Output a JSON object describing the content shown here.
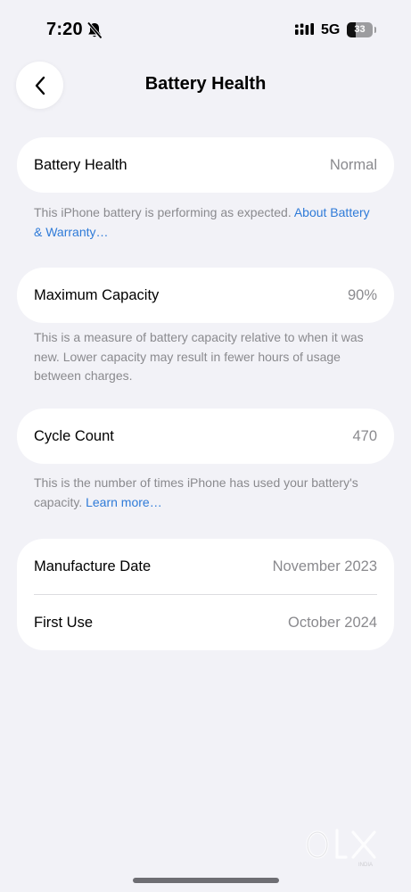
{
  "status_bar": {
    "time": "7:20",
    "network": "5G",
    "battery_percent": "33",
    "battery_level": 0.33,
    "icons": [
      "bell-muted-icon",
      "signal-icon",
      "battery-icon"
    ]
  },
  "nav": {
    "back_icon": "chevron-left-icon",
    "title": "Battery Health"
  },
  "battery_health": {
    "label": "Battery Health",
    "value": "Normal",
    "footnote_text": "This iPhone battery is performing as expected. ",
    "footnote_link": "About Battery & Warranty…"
  },
  "max_capacity": {
    "label": "Maximum Capacity",
    "value": "90%",
    "footnote": "This is a measure of battery capacity relative to when it was new. Lower capacity may result in fewer hours of usage between charges."
  },
  "cycle_count": {
    "label": "Cycle Count",
    "value": "470",
    "footnote_text": "This is the number of times iPhone has used your battery's capacity. ",
    "footnote_link": "Learn more…"
  },
  "dates": {
    "manufacture_label": "Manufacture Date",
    "manufacture_value": "November 2023",
    "first_use_label": "First Use",
    "first_use_value": "October 2024"
  },
  "watermark": {
    "text": "OLX",
    "sub": "INDIA"
  },
  "colors": {
    "background": "#f2f2f7",
    "card": "#ffffff",
    "link": "#2f7bd8",
    "secondary_text": "#8a8a8e"
  }
}
